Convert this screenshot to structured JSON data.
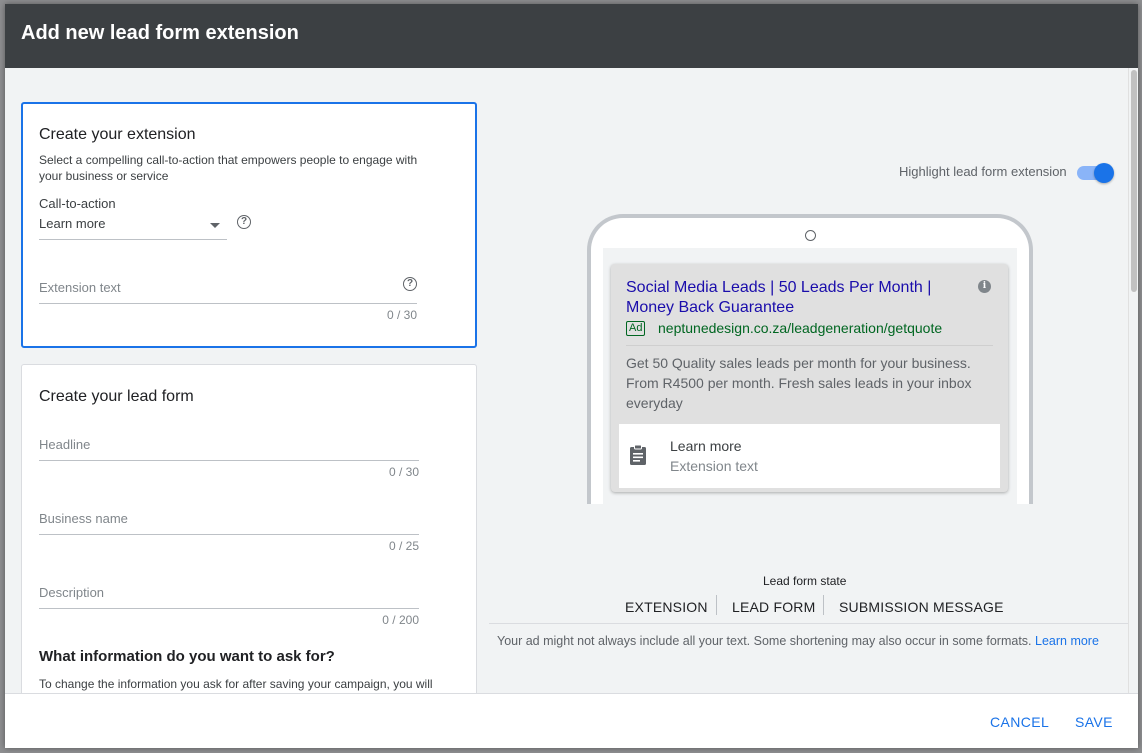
{
  "dialog": {
    "title": "Add new lead form extension"
  },
  "extension_card": {
    "title": "Create your extension",
    "subtitle": "Select a compelling call-to-action that empowers people to engage with your business or service",
    "cta_label": "Call-to-action",
    "cta_value": "Learn more",
    "extension_text_placeholder": "Extension text",
    "extension_text_counter": "0 / 30"
  },
  "lead_form_card": {
    "title": "Create your lead form",
    "headline_placeholder": "Headline",
    "headline_counter": "0 / 30",
    "business_name_placeholder": "Business name",
    "business_name_counter": "0 / 25",
    "description_placeholder": "Description",
    "description_counter": "0 / 200",
    "info_section_title": "What information do you want to ask for?",
    "info_section_text": "To change the information you ask for after saving your campaign, you will"
  },
  "preview": {
    "highlight_label": "Highlight lead form extension",
    "highlight_on": true,
    "ad_headline": "Social Media Leads | 50 Leads Per Month | Money Back Guarantee",
    "ad_badge": "Ad",
    "ad_url": "neptunedesign.co.za/leadgeneration/getquote",
    "ad_description": "Get 50 Quality sales leads per month for your business. From R4500 per month. Fresh sales leads in your inbox everyday",
    "extension_title": "Learn more",
    "extension_subtitle": "Extension text",
    "state_label": "Lead form state",
    "state_tabs": [
      "EXTENSION",
      "LEAD FORM",
      "SUBMISSION MESSAGE"
    ],
    "notice_text": "Your ad might not always include all your text. Some shortening may also occur in some formats.",
    "notice_link": "Learn more"
  },
  "footer": {
    "cancel_label": "CANCEL",
    "save_label": "SAVE"
  },
  "colors": {
    "header_bg": "#3c4043",
    "accent": "#1a73e8",
    "ad_link": "#1a0dab",
    "ad_url": "#006621"
  }
}
